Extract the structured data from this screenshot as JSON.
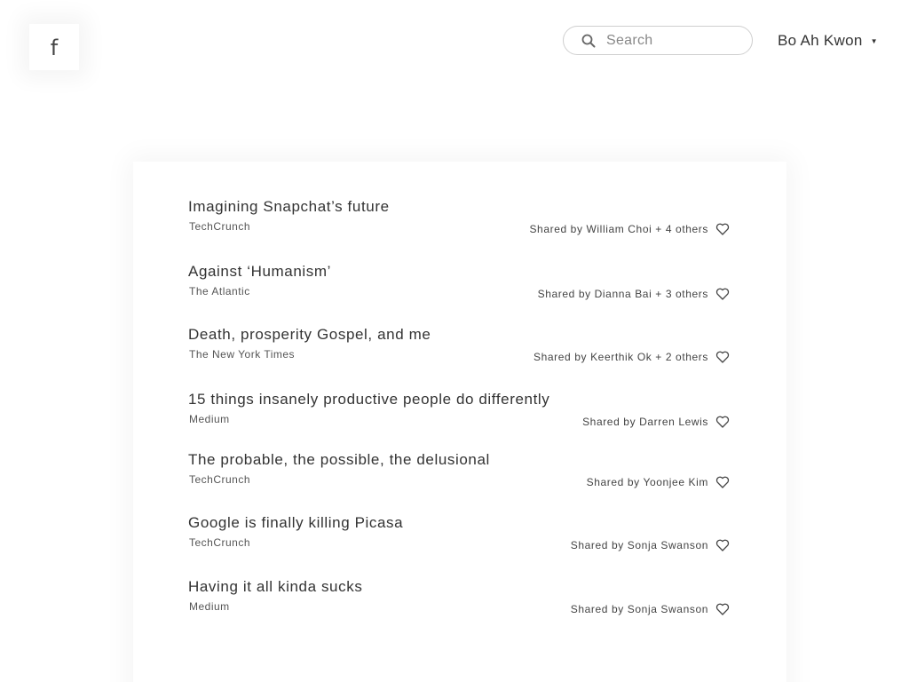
{
  "header": {
    "logo_letter": "f",
    "search_placeholder": "Search",
    "user_name": "Bo Ah Kwon",
    "caret": "▼"
  },
  "articles": [
    {
      "title": "Imagining Snapchat’s future",
      "source": "TechCrunch",
      "shared": "Shared by William Choi + 4 others"
    },
    {
      "title": "Against ‘Humanism’",
      "source": "The Atlantic",
      "shared": "Shared by Dianna Bai + 3 others"
    },
    {
      "title": "Death, prosperity Gospel, and me",
      "source": "The New York Times",
      "shared": "Shared by Keerthik Ok + 2 others"
    },
    {
      "title": "15 things insanely productive people do differently",
      "source": "Medium",
      "shared": "Shared by Darren Lewis"
    },
    {
      "title": "The probable, the possible, the delusional",
      "source": "TechCrunch",
      "shared": "Shared by Yoonjee Kim"
    },
    {
      "title": "Google is finally killing Picasa",
      "source": "TechCrunch",
      "shared": "Shared by Sonja Swanson"
    },
    {
      "title": "Having it all kinda sucks",
      "source": "Medium",
      "shared": "Shared by Sonja Swanson"
    }
  ],
  "icons": {
    "search": "search-icon",
    "like": "heart-icon"
  }
}
